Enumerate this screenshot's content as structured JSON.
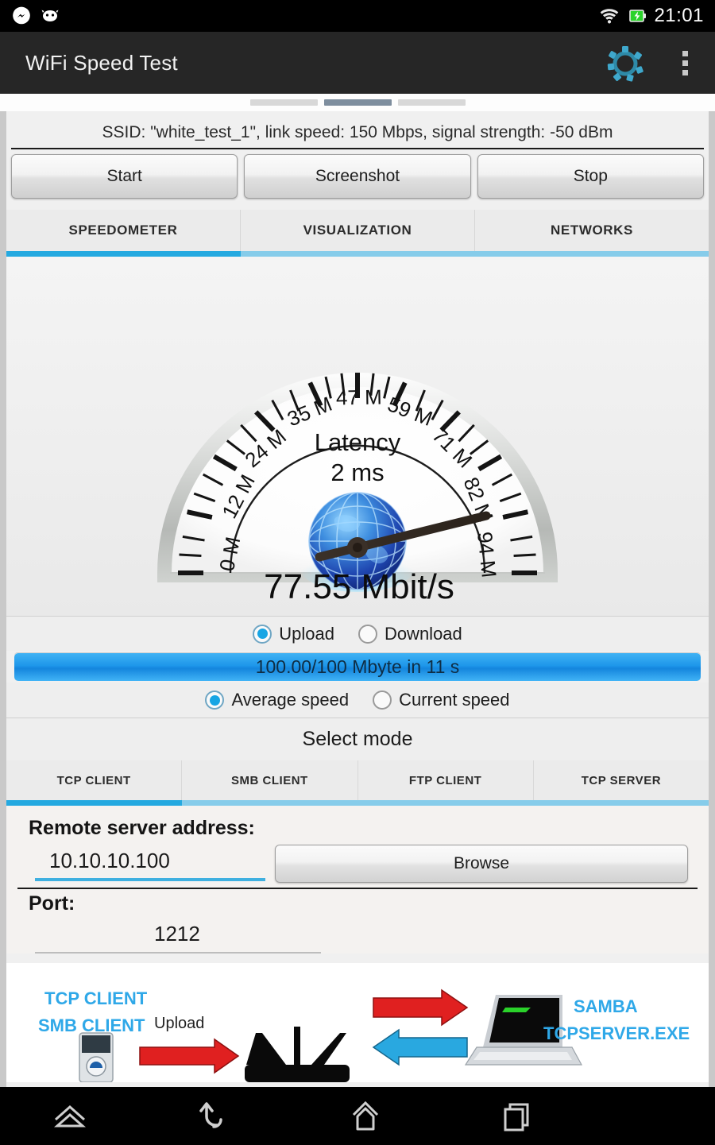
{
  "statusbar": {
    "clock": "21:01",
    "icons": [
      "messenger-icon",
      "app-notification-icon",
      "wifi-icon",
      "battery-charging-icon"
    ]
  },
  "appbar": {
    "title": "WiFi Speed Test",
    "gear_icon": "settings-gear-icon",
    "overflow_icon": "overflow-menu-icon"
  },
  "pager": {
    "count": 3,
    "active_index": 1
  },
  "info": {
    "ssid_line": "SSID: \"white_test_1\", link speed: 150 Mbps, signal strength: -50 dBm"
  },
  "actions": {
    "start": "Start",
    "screenshot": "Screenshot",
    "stop": "Stop"
  },
  "main_tabs": {
    "items": [
      "SPEEDOMETER",
      "VISUALIZATION",
      "NETWORKS"
    ],
    "active_index": 0,
    "active_color": "#24a9e0",
    "inactive_color": "#86ccea"
  },
  "gauge": {
    "latency_label": "Latency",
    "latency_value": "2 ms",
    "reading": "77.55 Mbit/s",
    "value": 77.55,
    "min": 0,
    "max": 100,
    "tick_labels": [
      "0 M",
      "12 M",
      "24 M",
      "35 M",
      "47 M",
      "59 M",
      "71 M",
      "82 M",
      "94 M"
    ],
    "tick_values": [
      0,
      12,
      24,
      35,
      47,
      59,
      71,
      82,
      94
    ],
    "globe_icon": "globe-icon"
  },
  "direction": {
    "options": [
      "Upload",
      "Download"
    ],
    "selected": "Upload"
  },
  "progress": {
    "text": "100.00/100 Mbyte in 11 s",
    "percent": 100,
    "color": "#1e97ea"
  },
  "speed_mode": {
    "options": [
      "Average speed",
      "Current speed"
    ],
    "selected": "Average speed"
  },
  "select_mode": {
    "title": "Select mode",
    "tabs": [
      "TCP CLIENT",
      "SMB CLIENT",
      "FTP CLIENT",
      "TCP SERVER"
    ],
    "active_index": 0
  },
  "form": {
    "address_label": "Remote server address:",
    "address_value": "10.10.10.100",
    "address_placeholder": "10.10.10.100",
    "browse_label": "Browse",
    "port_label": "Port:",
    "port_value": "1212",
    "port_placeholder": "1212"
  },
  "diagram": {
    "client_line1": "TCP CLIENT",
    "client_line2": "SMB CLIENT",
    "upload_label": "Upload",
    "server_line1": "SAMBA",
    "server_line2": "TCPSERVER.EXE",
    "phone_icon": "smartphone-icon",
    "router_icon": "wifi-router-icon",
    "laptop_icon": "laptop-icon",
    "arrow_up_color": "#e02020",
    "arrow_down_color": "#29a8e0",
    "label_color": "#2fa8e8"
  },
  "navbar": {
    "items": [
      "menu-icon",
      "back-icon",
      "home-icon",
      "recents-icon"
    ]
  }
}
